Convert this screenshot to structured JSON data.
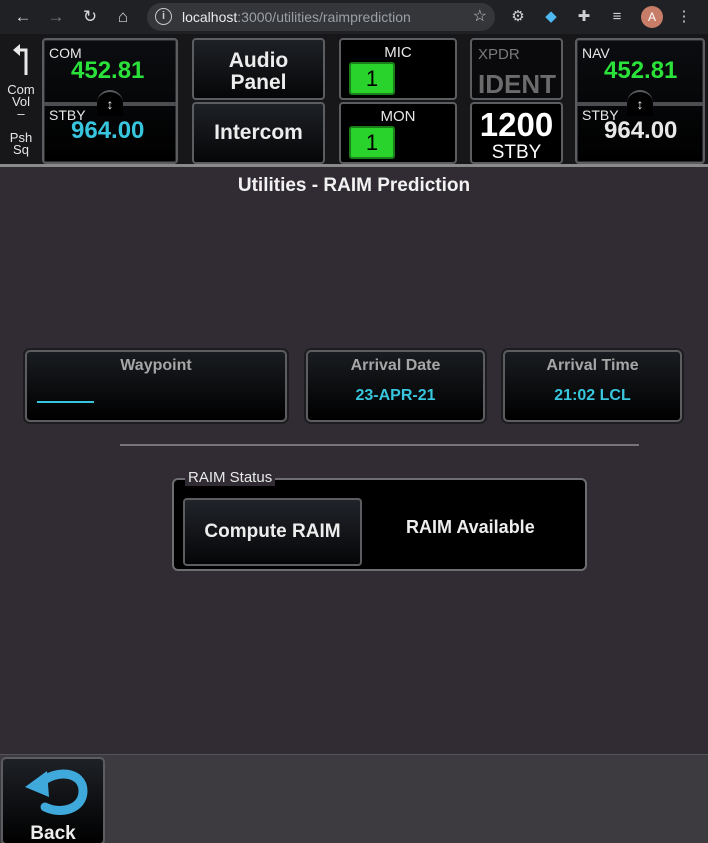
{
  "browser": {
    "url_host": "localhost",
    "url_path": ":3000/utilities/raimprediction",
    "avatar_letter": "A"
  },
  "topbar": {
    "knob_top": "Com",
    "knob_mid": "Vol",
    "knob_dash": "–",
    "knob_psh": "Psh",
    "knob_sq": "Sq",
    "com": {
      "label": "COM",
      "active": "452.81",
      "stby_label": "STBY",
      "stby": "964.00"
    },
    "audio_panel_label_1": "Audio",
    "audio_panel_label_2": "Panel",
    "intercom_label": "Intercom",
    "mic": {
      "label": "MIC",
      "value": "1"
    },
    "mon": {
      "label": "MON",
      "value": "1"
    },
    "xpdr": {
      "label": "XPDR",
      "ident": "IDENT",
      "code": "1200",
      "mode": "STBY"
    },
    "nav": {
      "label": "NAV",
      "active": "452.81",
      "stby_label": "STBY",
      "stby": "964.00"
    }
  },
  "page": {
    "title": "Utilities - RAIM Prediction"
  },
  "fields": {
    "waypoint": {
      "header": "Waypoint",
      "value": ""
    },
    "arrival_date": {
      "header": "Arrival Date",
      "value": "23-APR-21"
    },
    "arrival_time": {
      "header": "Arrival Time",
      "value": "21:02 LCL"
    }
  },
  "raim": {
    "legend": "RAIM Status",
    "compute_label": "Compute RAIM",
    "status": "RAIM Available"
  },
  "bottom": {
    "back_label": "Back"
  },
  "colors": {
    "active_freq": "#2be23a",
    "standby_freq": "#38c6df",
    "mic_on": "#29d32b"
  }
}
